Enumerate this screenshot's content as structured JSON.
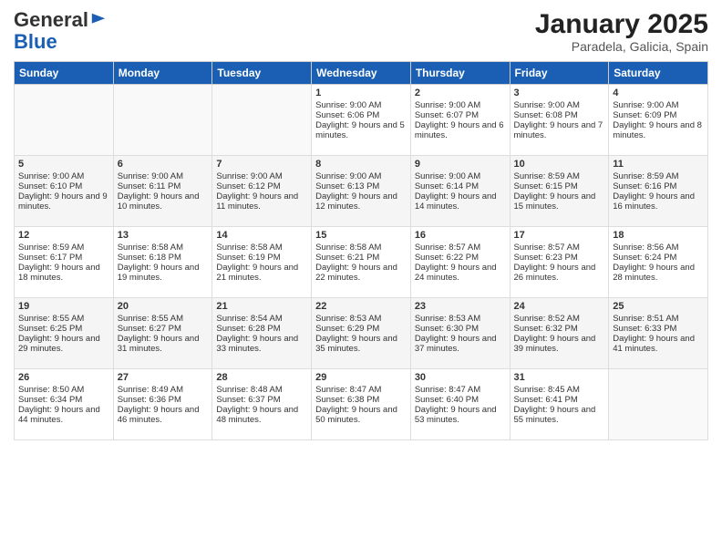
{
  "header": {
    "logo_general": "General",
    "logo_blue": "Blue",
    "month_title": "January 2025",
    "location": "Paradela, Galicia, Spain"
  },
  "days_of_week": [
    "Sunday",
    "Monday",
    "Tuesday",
    "Wednesday",
    "Thursday",
    "Friday",
    "Saturday"
  ],
  "weeks": [
    [
      {
        "day": "",
        "sunrise": "",
        "sunset": "",
        "daylight": ""
      },
      {
        "day": "",
        "sunrise": "",
        "sunset": "",
        "daylight": ""
      },
      {
        "day": "",
        "sunrise": "",
        "sunset": "",
        "daylight": ""
      },
      {
        "day": "1",
        "sunrise": "Sunrise: 9:00 AM",
        "sunset": "Sunset: 6:06 PM",
        "daylight": "Daylight: 9 hours and 5 minutes."
      },
      {
        "day": "2",
        "sunrise": "Sunrise: 9:00 AM",
        "sunset": "Sunset: 6:07 PM",
        "daylight": "Daylight: 9 hours and 6 minutes."
      },
      {
        "day": "3",
        "sunrise": "Sunrise: 9:00 AM",
        "sunset": "Sunset: 6:08 PM",
        "daylight": "Daylight: 9 hours and 7 minutes."
      },
      {
        "day": "4",
        "sunrise": "Sunrise: 9:00 AM",
        "sunset": "Sunset: 6:09 PM",
        "daylight": "Daylight: 9 hours and 8 minutes."
      }
    ],
    [
      {
        "day": "5",
        "sunrise": "Sunrise: 9:00 AM",
        "sunset": "Sunset: 6:10 PM",
        "daylight": "Daylight: 9 hours and 9 minutes."
      },
      {
        "day": "6",
        "sunrise": "Sunrise: 9:00 AM",
        "sunset": "Sunset: 6:11 PM",
        "daylight": "Daylight: 9 hours and 10 minutes."
      },
      {
        "day": "7",
        "sunrise": "Sunrise: 9:00 AM",
        "sunset": "Sunset: 6:12 PM",
        "daylight": "Daylight: 9 hours and 11 minutes."
      },
      {
        "day": "8",
        "sunrise": "Sunrise: 9:00 AM",
        "sunset": "Sunset: 6:13 PM",
        "daylight": "Daylight: 9 hours and 12 minutes."
      },
      {
        "day": "9",
        "sunrise": "Sunrise: 9:00 AM",
        "sunset": "Sunset: 6:14 PM",
        "daylight": "Daylight: 9 hours and 14 minutes."
      },
      {
        "day": "10",
        "sunrise": "Sunrise: 8:59 AM",
        "sunset": "Sunset: 6:15 PM",
        "daylight": "Daylight: 9 hours and 15 minutes."
      },
      {
        "day": "11",
        "sunrise": "Sunrise: 8:59 AM",
        "sunset": "Sunset: 6:16 PM",
        "daylight": "Daylight: 9 hours and 16 minutes."
      }
    ],
    [
      {
        "day": "12",
        "sunrise": "Sunrise: 8:59 AM",
        "sunset": "Sunset: 6:17 PM",
        "daylight": "Daylight: 9 hours and 18 minutes."
      },
      {
        "day": "13",
        "sunrise": "Sunrise: 8:58 AM",
        "sunset": "Sunset: 6:18 PM",
        "daylight": "Daylight: 9 hours and 19 minutes."
      },
      {
        "day": "14",
        "sunrise": "Sunrise: 8:58 AM",
        "sunset": "Sunset: 6:19 PM",
        "daylight": "Daylight: 9 hours and 21 minutes."
      },
      {
        "day": "15",
        "sunrise": "Sunrise: 8:58 AM",
        "sunset": "Sunset: 6:21 PM",
        "daylight": "Daylight: 9 hours and 22 minutes."
      },
      {
        "day": "16",
        "sunrise": "Sunrise: 8:57 AM",
        "sunset": "Sunset: 6:22 PM",
        "daylight": "Daylight: 9 hours and 24 minutes."
      },
      {
        "day": "17",
        "sunrise": "Sunrise: 8:57 AM",
        "sunset": "Sunset: 6:23 PM",
        "daylight": "Daylight: 9 hours and 26 minutes."
      },
      {
        "day": "18",
        "sunrise": "Sunrise: 8:56 AM",
        "sunset": "Sunset: 6:24 PM",
        "daylight": "Daylight: 9 hours and 28 minutes."
      }
    ],
    [
      {
        "day": "19",
        "sunrise": "Sunrise: 8:55 AM",
        "sunset": "Sunset: 6:25 PM",
        "daylight": "Daylight: 9 hours and 29 minutes."
      },
      {
        "day": "20",
        "sunrise": "Sunrise: 8:55 AM",
        "sunset": "Sunset: 6:27 PM",
        "daylight": "Daylight: 9 hours and 31 minutes."
      },
      {
        "day": "21",
        "sunrise": "Sunrise: 8:54 AM",
        "sunset": "Sunset: 6:28 PM",
        "daylight": "Daylight: 9 hours and 33 minutes."
      },
      {
        "day": "22",
        "sunrise": "Sunrise: 8:53 AM",
        "sunset": "Sunset: 6:29 PM",
        "daylight": "Daylight: 9 hours and 35 minutes."
      },
      {
        "day": "23",
        "sunrise": "Sunrise: 8:53 AM",
        "sunset": "Sunset: 6:30 PM",
        "daylight": "Daylight: 9 hours and 37 minutes."
      },
      {
        "day": "24",
        "sunrise": "Sunrise: 8:52 AM",
        "sunset": "Sunset: 6:32 PM",
        "daylight": "Daylight: 9 hours and 39 minutes."
      },
      {
        "day": "25",
        "sunrise": "Sunrise: 8:51 AM",
        "sunset": "Sunset: 6:33 PM",
        "daylight": "Daylight: 9 hours and 41 minutes."
      }
    ],
    [
      {
        "day": "26",
        "sunrise": "Sunrise: 8:50 AM",
        "sunset": "Sunset: 6:34 PM",
        "daylight": "Daylight: 9 hours and 44 minutes."
      },
      {
        "day": "27",
        "sunrise": "Sunrise: 8:49 AM",
        "sunset": "Sunset: 6:36 PM",
        "daylight": "Daylight: 9 hours and 46 minutes."
      },
      {
        "day": "28",
        "sunrise": "Sunrise: 8:48 AM",
        "sunset": "Sunset: 6:37 PM",
        "daylight": "Daylight: 9 hours and 48 minutes."
      },
      {
        "day": "29",
        "sunrise": "Sunrise: 8:47 AM",
        "sunset": "Sunset: 6:38 PM",
        "daylight": "Daylight: 9 hours and 50 minutes."
      },
      {
        "day": "30",
        "sunrise": "Sunrise: 8:47 AM",
        "sunset": "Sunset: 6:40 PM",
        "daylight": "Daylight: 9 hours and 53 minutes."
      },
      {
        "day": "31",
        "sunrise": "Sunrise: 8:45 AM",
        "sunset": "Sunset: 6:41 PM",
        "daylight": "Daylight: 9 hours and 55 minutes."
      },
      {
        "day": "",
        "sunrise": "",
        "sunset": "",
        "daylight": ""
      }
    ]
  ]
}
